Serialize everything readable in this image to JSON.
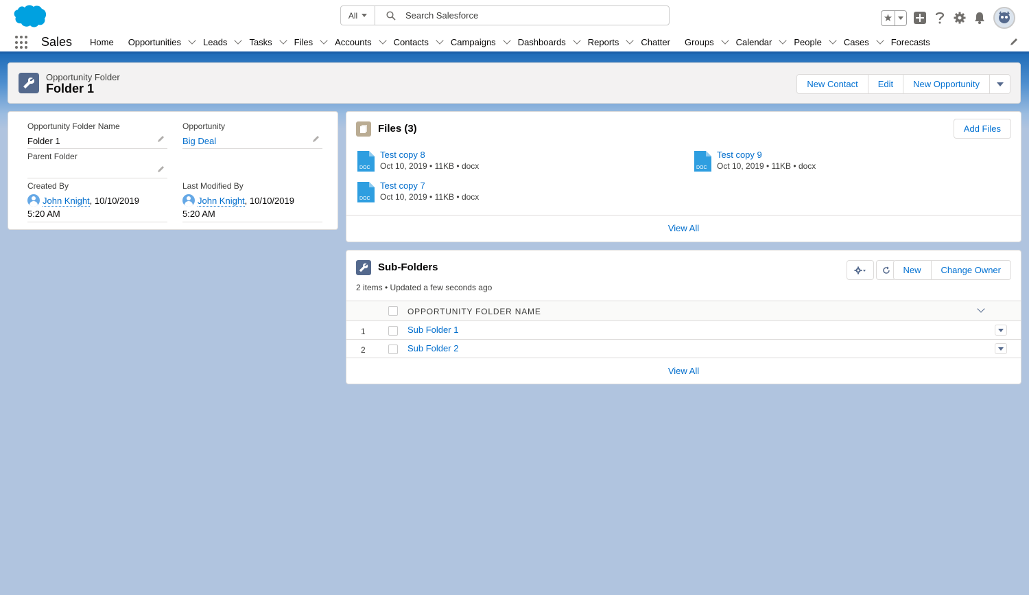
{
  "header": {
    "search_scope": "All",
    "search_placeholder": "Search Salesforce"
  },
  "nav": {
    "app_name": "Sales",
    "items": [
      {
        "label": "Home",
        "has_menu": false
      },
      {
        "label": "Opportunities",
        "has_menu": true
      },
      {
        "label": "Leads",
        "has_menu": true
      },
      {
        "label": "Tasks",
        "has_menu": true
      },
      {
        "label": "Files",
        "has_menu": true
      },
      {
        "label": "Accounts",
        "has_menu": true
      },
      {
        "label": "Contacts",
        "has_menu": true
      },
      {
        "label": "Campaigns",
        "has_menu": true
      },
      {
        "label": "Dashboards",
        "has_menu": true
      },
      {
        "label": "Reports",
        "has_menu": true
      },
      {
        "label": "Chatter",
        "has_menu": false
      },
      {
        "label": "Groups",
        "has_menu": true
      },
      {
        "label": "Calendar",
        "has_menu": true
      },
      {
        "label": "People",
        "has_menu": true
      },
      {
        "label": "Cases",
        "has_menu": true
      },
      {
        "label": "Forecasts",
        "has_menu": false
      }
    ]
  },
  "record": {
    "type_label": "Opportunity Folder",
    "title": "Folder 1",
    "actions": [
      "New Contact",
      "Edit",
      "New Opportunity"
    ]
  },
  "details": {
    "folder_name_label": "Opportunity Folder Name",
    "folder_name_value": "Folder 1",
    "opportunity_label": "Opportunity",
    "opportunity_value": "Big Deal",
    "parent_folder_label": "Parent Folder",
    "parent_folder_value": "",
    "created_by_label": "Created By",
    "created_by_user": "John Knight",
    "created_by_date": ", 10/10/2019",
    "created_by_time": "5:20 AM",
    "modified_by_label": "Last Modified By",
    "modified_by_user": "John Knight",
    "modified_by_date": ", 10/10/2019",
    "modified_by_time": "5:20 AM"
  },
  "files": {
    "title": "Files (3)",
    "add_button": "Add Files",
    "icon_label": "DOC",
    "items": [
      {
        "name": "Test copy 8",
        "date": "Oct 10, 2019",
        "size": "11KB",
        "ext": "docx"
      },
      {
        "name": "Test copy 9",
        "date": "Oct 10, 2019",
        "size": "11KB",
        "ext": "docx"
      },
      {
        "name": "Test copy 7",
        "date": "Oct 10, 2019",
        "size": "11KB",
        "ext": "docx"
      }
    ],
    "view_all": "View All"
  },
  "subfolders": {
    "title": "Sub-Folders",
    "status": "2 items • Updated a few seconds ago",
    "new_button": "New",
    "change_owner_button": "Change Owner",
    "column_header": "OPPORTUNITY FOLDER NAME",
    "rows": [
      {
        "num": "1",
        "name": "Sub Folder 1"
      },
      {
        "num": "2",
        "name": "Sub Folder 2"
      }
    ],
    "view_all": "View All"
  },
  "colors": {
    "brand_blue": "#0070d2",
    "link_blue": "#006dcc",
    "page_bg": "#b0c4df",
    "record_icon": "#54698d"
  }
}
